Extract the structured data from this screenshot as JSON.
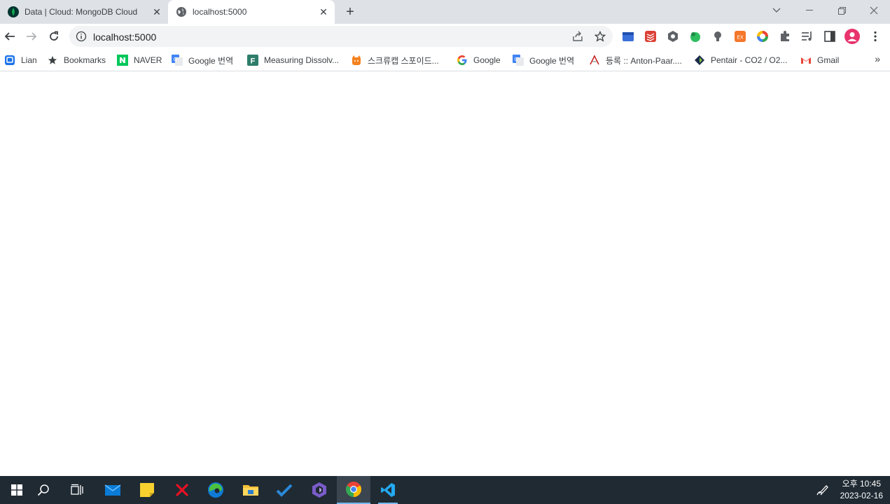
{
  "browser": {
    "tabs": [
      {
        "title": "Data | Cloud: MongoDB Cloud",
        "icon": "mongodb-leaf-icon",
        "active": false
      },
      {
        "title": "localhost:5000",
        "icon": "globe-icon",
        "active": true
      }
    ],
    "address_bar": {
      "url": "localhost:5000"
    }
  },
  "bookmarks": [
    {
      "label": "Lian",
      "icon": "lian-icon"
    },
    {
      "label": "Bookmarks",
      "icon": "star-icon"
    },
    {
      "label": "NAVER",
      "icon": "naver-icon"
    },
    {
      "label": "Google 번역",
      "icon": "google-translate-icon"
    },
    {
      "label": "Measuring Dissolv...",
      "icon": "f-icon"
    },
    {
      "label": "스크류캡 스포이드...",
      "icon": "shop-cat-icon"
    },
    {
      "label": "Google",
      "icon": "google-icon"
    },
    {
      "label": "Google 번역",
      "icon": "google-translate-icon"
    },
    {
      "label": "등록 :: Anton-Paar....",
      "icon": "anton-paar-icon"
    },
    {
      "label": "Pentair - CO2 / O2...",
      "icon": "pentair-icon"
    },
    {
      "label": "Gmail",
      "icon": "gmail-icon"
    }
  ],
  "taskbar": {
    "clock_time": "오후 10:45",
    "clock_date": "2023-02-16"
  },
  "colors": {
    "tabstrip_bg": "#dee1e6",
    "taskbar_bg": "#1f2a33",
    "accent": "#76b9ed"
  }
}
